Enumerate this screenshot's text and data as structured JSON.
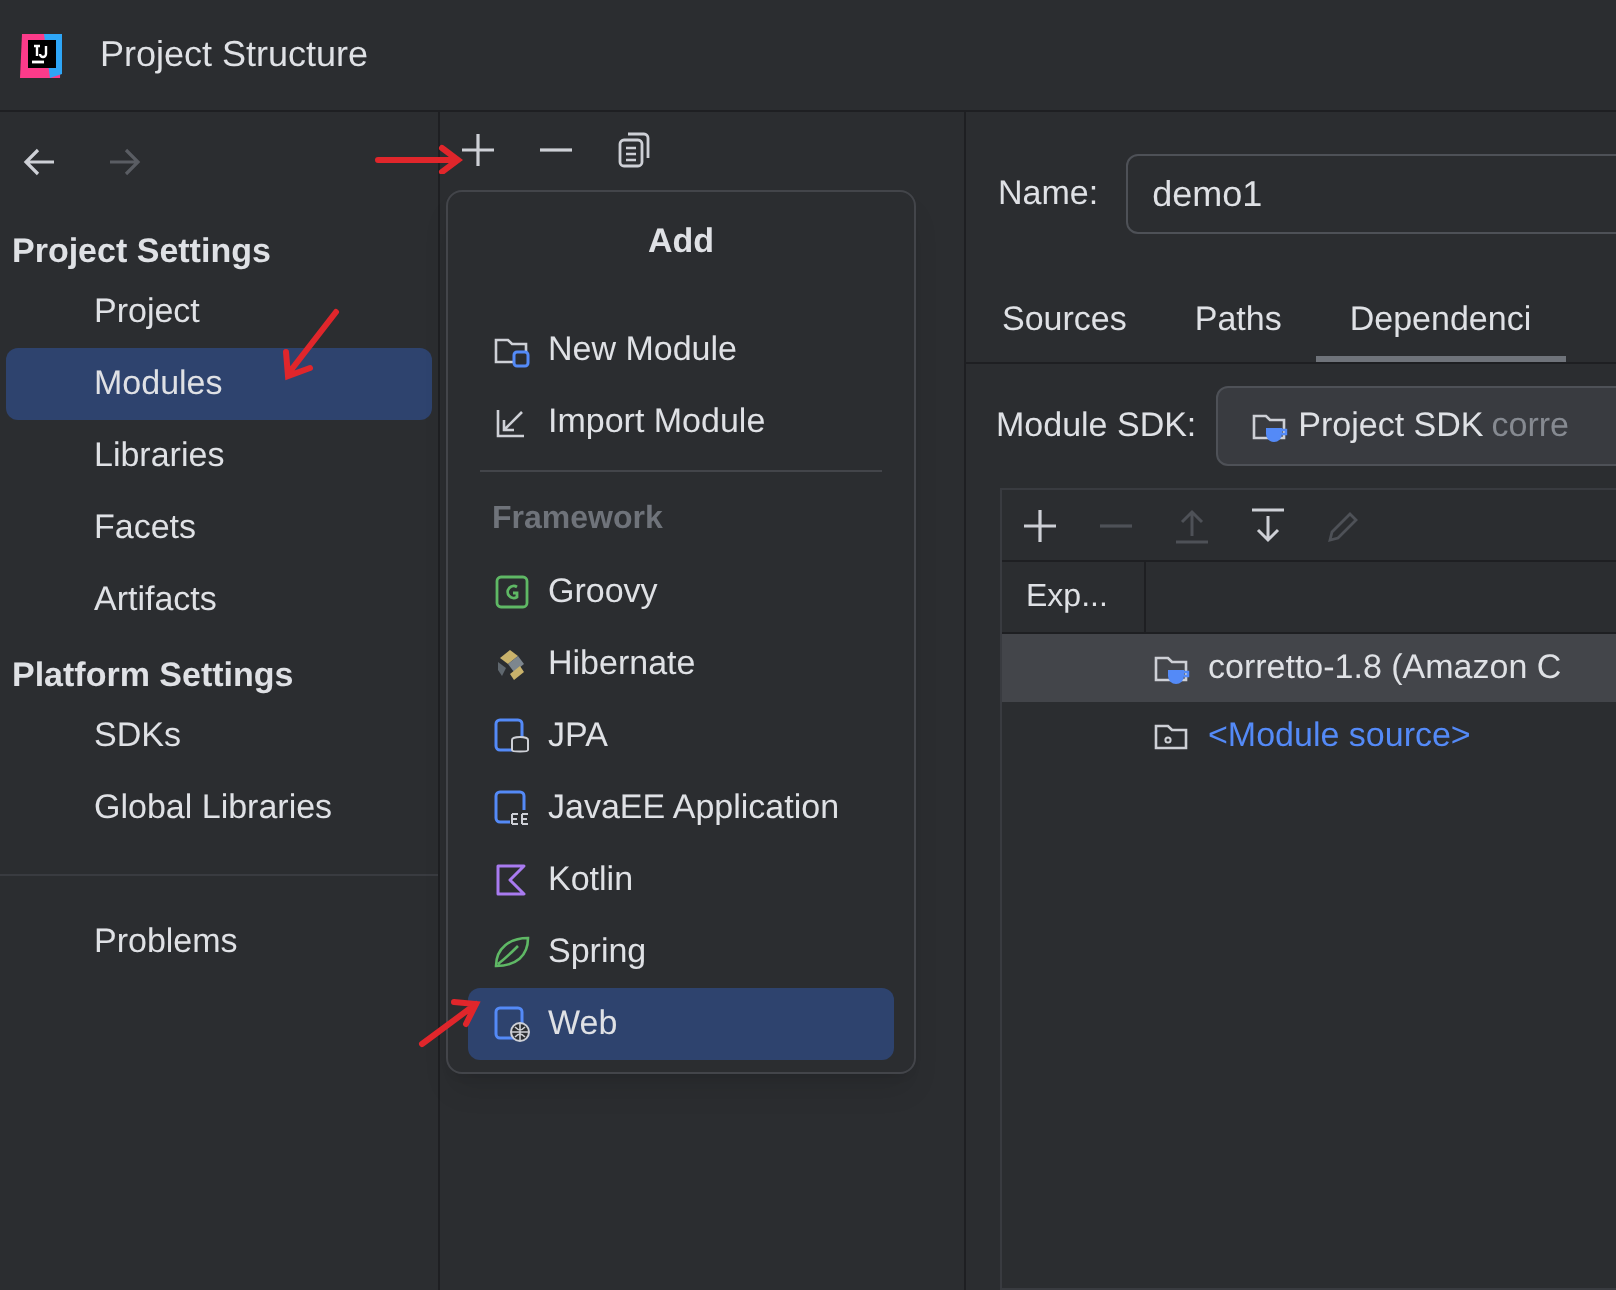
{
  "window": {
    "title": "Project Structure"
  },
  "nav": [
    {
      "kind": "back",
      "disabled": false
    },
    {
      "kind": "forward",
      "disabled": true
    }
  ],
  "sidebar": {
    "sections": [
      {
        "heading": "Project Settings",
        "items": [
          {
            "label": "Project",
            "selected": false
          },
          {
            "label": "Modules",
            "selected": true
          },
          {
            "label": "Libraries",
            "selected": false
          },
          {
            "label": "Facets",
            "selected": false
          },
          {
            "label": "Artifacts",
            "selected": false
          }
        ]
      },
      {
        "heading": "Platform Settings",
        "items": [
          {
            "label": "SDKs",
            "selected": false
          },
          {
            "label": "Global Libraries",
            "selected": false
          }
        ]
      }
    ],
    "footer_items": [
      {
        "label": "Problems",
        "selected": false
      }
    ]
  },
  "add_menu": {
    "title": "Add",
    "items": [
      {
        "label": "New Module",
        "kind": "new-module",
        "selected": false
      },
      {
        "label": "Import Module",
        "kind": "import",
        "selected": false
      }
    ],
    "section": "Framework",
    "framework_items": [
      {
        "label": "Groovy",
        "kind": "groovy",
        "selected": false
      },
      {
        "label": "Hibernate",
        "kind": "hibernate",
        "selected": false
      },
      {
        "label": "JPA",
        "kind": "jpa",
        "selected": false
      },
      {
        "label": "JavaEE Application",
        "kind": "javaee",
        "selected": false
      },
      {
        "label": "Kotlin",
        "kind": "kotlin",
        "selected": false
      },
      {
        "label": "Spring",
        "kind": "spring",
        "selected": false
      },
      {
        "label": "Web",
        "kind": "web",
        "selected": true
      }
    ]
  },
  "name_field": {
    "label": "Name:",
    "value": "demo1"
  },
  "tabs": [
    {
      "label": "Sources",
      "selected": false
    },
    {
      "label": "Paths",
      "selected": false
    },
    {
      "label": "Dependenci",
      "selected": true
    }
  ],
  "module_sdk": {
    "label": "Module SDK:",
    "value": "Project SDK",
    "detail": "corre"
  },
  "dependency_toolbar": [
    {
      "kind": "add",
      "disabled": false
    },
    {
      "kind": "remove",
      "disabled": true
    },
    {
      "kind": "up",
      "disabled": true
    },
    {
      "kind": "down",
      "disabled": false
    },
    {
      "kind": "edit",
      "disabled": true
    }
  ],
  "table": {
    "columns": [
      "Exp..."
    ],
    "rows": [
      {
        "label": "corretto-1.8 (Amazon C",
        "kind": "sdk",
        "selected": true
      },
      {
        "label": "<Module source>",
        "kind": "source",
        "selected": false
      }
    ]
  }
}
